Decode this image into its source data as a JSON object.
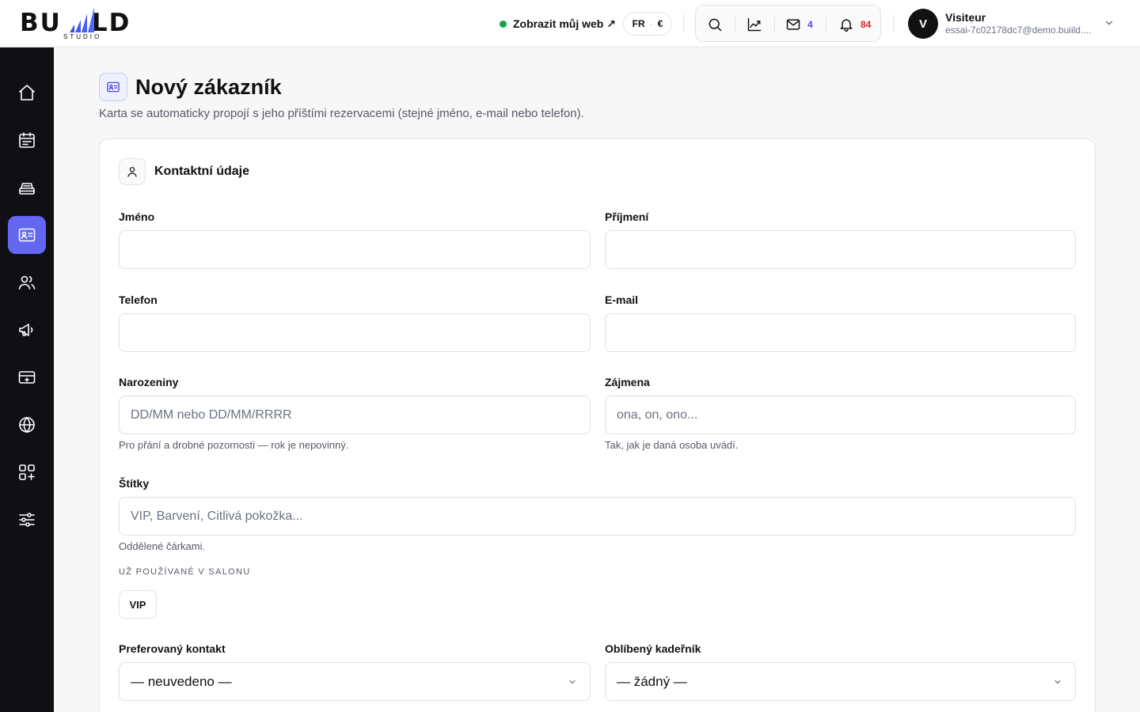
{
  "brand": {
    "logo_text": "BU LD",
    "logo_sub": "STUDIO"
  },
  "header": {
    "view_site_label": "Zobrazit můj web ↗",
    "lang": "FR",
    "currency": "€",
    "messages_count": "4",
    "notifications_count": "84",
    "user": {
      "initial": "V",
      "name": "Visiteur",
      "email": "essai-7c02178dc7@demo.buiild...."
    }
  },
  "sidebar": {
    "items": [
      {
        "icon": "home-icon"
      },
      {
        "icon": "calendar-icon"
      },
      {
        "icon": "register-icon"
      },
      {
        "icon": "contact-card-icon",
        "active": true
      },
      {
        "icon": "users-icon"
      },
      {
        "icon": "megaphone-icon"
      },
      {
        "icon": "payment-card-icon"
      },
      {
        "icon": "globe-icon"
      },
      {
        "icon": "apps-add-icon"
      },
      {
        "icon": "sliders-icon"
      }
    ]
  },
  "page": {
    "title": "Nový zákazník",
    "subtitle": "Karta se automaticky propojí s jeho příštími rezervacemi (stejné jméno, e-mail nebo telefon)."
  },
  "form": {
    "section_title": "Kontaktní údaje",
    "first_name": {
      "label": "Jméno",
      "value": "",
      "placeholder": ""
    },
    "last_name": {
      "label": "Příjmení",
      "value": "",
      "placeholder": ""
    },
    "phone": {
      "label": "Telefon",
      "value": "",
      "placeholder": ""
    },
    "email": {
      "label": "E-mail",
      "value": "",
      "placeholder": ""
    },
    "birthday": {
      "label": "Narozeniny",
      "placeholder": "DD/MM nebo DD/MM/RRRR",
      "hint": "Pro přání a drobné pozornosti — rok je nepovinný."
    },
    "pronouns": {
      "label": "Zájmena",
      "placeholder": "ona, on, ono...",
      "hint": "Tak, jak je daná osoba uvádí."
    },
    "tags": {
      "label": "Štítky",
      "placeholder": "VIP, Barvení, Citlivá pokožka...",
      "hint": "Oddělené čárkami.",
      "used_label": "UŽ POUŽÍVANÉ V SALONU",
      "used": [
        "VIP"
      ]
    },
    "preferred_contact": {
      "label": "Preferovaný kontakt",
      "value": "— neuvedeno —"
    },
    "favorite_stylist": {
      "label": "Oblíbený kadeřník",
      "value": "— žádný —"
    }
  },
  "colors": {
    "accent": "#6366f1",
    "online": "#16a34a",
    "messages": "#4f46e5",
    "notifications": "#dc2626",
    "sidebar": "#101014"
  }
}
